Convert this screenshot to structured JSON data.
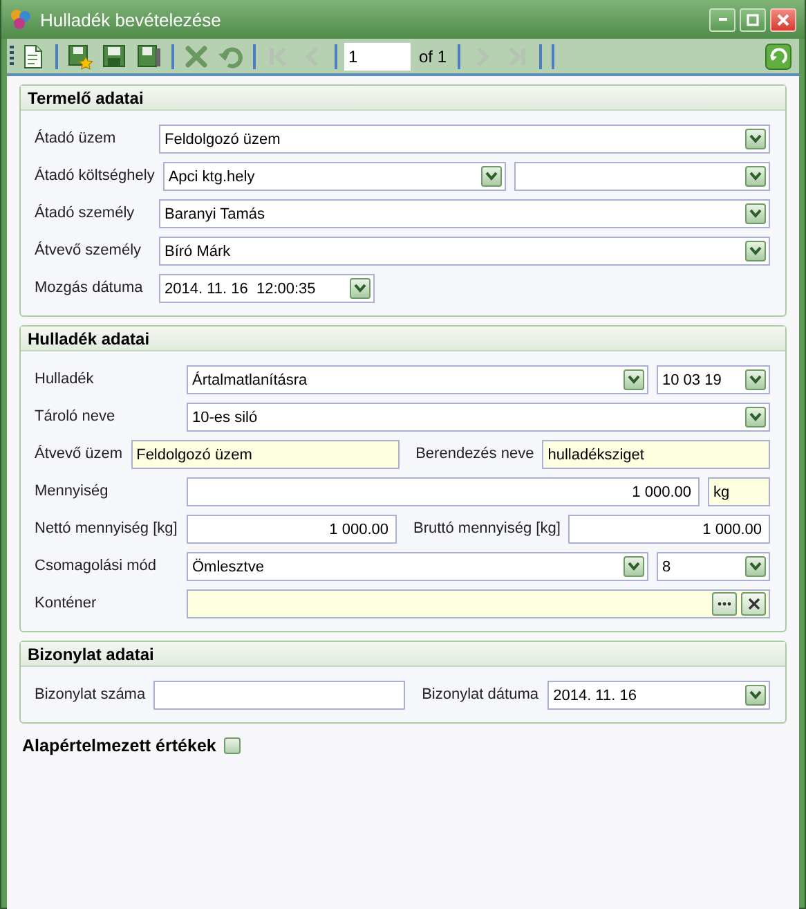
{
  "window": {
    "title": "Hulladék bevételezése",
    "buttons": [
      {
        "kind": "minimize"
      },
      {
        "kind": "maximize"
      },
      {
        "kind": "close"
      }
    ]
  },
  "toolbar": {
    "buttons": [
      {
        "kind": "new",
        "disabled": false
      },
      {
        "kind": "save-new",
        "disabled": false
      },
      {
        "kind": "save",
        "disabled": false
      },
      {
        "kind": "save-close",
        "disabled": false
      },
      {
        "kind": "delete",
        "disabled": false
      },
      {
        "kind": "undo",
        "disabled": false
      },
      {
        "kind": "first",
        "disabled": true
      },
      {
        "kind": "prev",
        "disabled": true
      }
    ],
    "page": "1",
    "page_count": "of 1",
    "nav_buttons": [
      {
        "kind": "next",
        "disabled": true
      },
      {
        "kind": "last",
        "disabled": true
      }
    ],
    "refresh": {
      "kind": "refresh",
      "disabled": false
    }
  },
  "sections": [
    {
      "title": "Termelő adatai",
      "rows": [
        [
          {
            "kind": "label",
            "text": "Átadó üzem"
          },
          {
            "kind": "dropdown",
            "value": "Feldolgozó üzem"
          }
        ],
        [
          {
            "kind": "label",
            "text": "Átadó költséghely"
          },
          {
            "kind": "dropdown",
            "value": "Apci ktg.hely"
          },
          {
            "kind": "dropdown"
          }
        ],
        [
          {
            "kind": "label",
            "text": "Átadó személy"
          },
          {
            "kind": "dropdown",
            "value": "Baranyi Tamás"
          }
        ],
        [
          {
            "kind": "label",
            "text": "Átvevő személy"
          },
          {
            "kind": "dropdown",
            "value": "Bíró Márk"
          }
        ],
        [
          {
            "kind": "label",
            "text": "Mozgás dátuma"
          },
          {
            "kind": "dropdown",
            "value": "2014. 11. 16  12:00:35"
          }
        ]
      ]
    },
    {
      "title": "Hulladék adatai",
      "rows": [
        [
          {
            "kind": "label",
            "text": "Hulladék"
          },
          {
            "kind": "dropdown",
            "value": "Ártalmatlanításra"
          },
          {
            "kind": "dropdown",
            "value": "10 03 19"
          }
        ],
        [
          {
            "kind": "label",
            "text": "Tároló neve"
          },
          {
            "kind": "dropdown",
            "value": "10-es siló"
          }
        ],
        [
          {
            "kind": "label",
            "text": "Átvevő üzem"
          },
          {
            "kind": "readonly",
            "value": "Feldolgozó üzem"
          },
          {
            "kind": "label",
            "text": "Berendezés neve"
          },
          {
            "kind": "readonly",
            "value": "hulladéksziget"
          }
        ],
        [
          {
            "kind": "label",
            "text": "Mennyiség"
          },
          {
            "kind": "number",
            "value": "1 000.00"
          },
          {
            "kind": "readonly",
            "value": "kg"
          }
        ],
        [
          {
            "kind": "label",
            "text": "Nettó mennyiség [kg]"
          },
          {
            "kind": "number",
            "value": "1 000.00"
          },
          {
            "kind": "label",
            "text": "Bruttó mennyiség [kg]"
          },
          {
            "kind": "number",
            "value": "1 000.00"
          }
        ],
        [
          {
            "kind": "label",
            "text": "Csomagolási mód"
          },
          {
            "kind": "dropdown",
            "value": "Ömlesztve"
          },
          {
            "kind": "dropdown",
            "value": "8"
          }
        ],
        [
          {
            "kind": "label",
            "text": "Konténer"
          },
          {
            "kind": "lookup"
          }
        ]
      ]
    },
    {
      "title": "Bizonylat adatai",
      "rows": [
        [
          {
            "kind": "label",
            "text": "Bizonylat száma"
          },
          {
            "kind": "text"
          },
          {
            "kind": "label",
            "text": "Bizonylat dátuma"
          },
          {
            "kind": "dropdown",
            "value": "2014. 11. 16"
          }
        ]
      ]
    }
  ],
  "defaults": {
    "label": "Alapértelmezett értékek",
    "checked": false
  }
}
